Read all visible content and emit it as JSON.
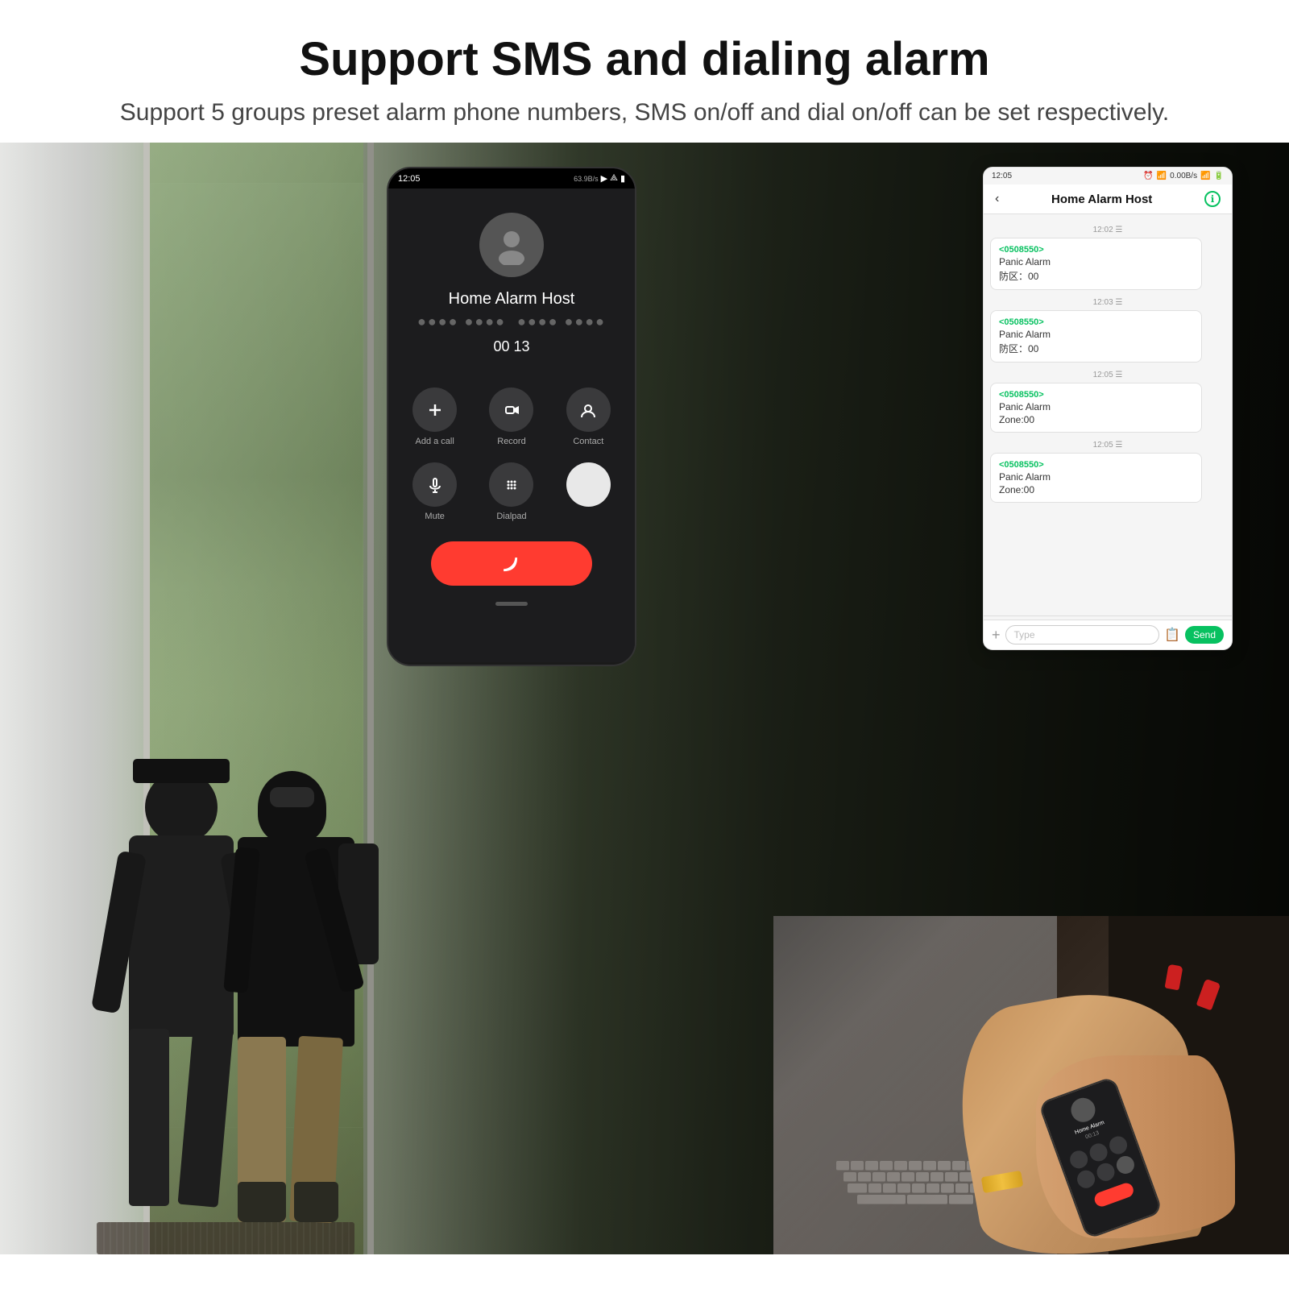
{
  "header": {
    "title": "Support SMS and dialing alarm",
    "subtitle": "Support 5 groups preset alarm phone numbers, SMS on/off and dial on/off can be set respectively."
  },
  "phone_call": {
    "status_bar": {
      "time": "12:05",
      "signal": "63.9B/s"
    },
    "caller_name": "Home Alarm Host",
    "caller_number": "●●●●●●●● ●●●●●●●●",
    "duration": "00 13",
    "buttons": [
      {
        "label": "Add a call",
        "icon": "plus"
      },
      {
        "label": "Record",
        "icon": "record"
      },
      {
        "label": "Contact",
        "icon": "contact"
      },
      {
        "label": "Mute",
        "icon": "mute"
      },
      {
        "label": "Dialpad",
        "icon": "dialpad"
      }
    ]
  },
  "phone_sms": {
    "status_bar": {
      "time": "12:05",
      "speed": "0.00B/s"
    },
    "contact_name": "Home Alarm Host",
    "messages": [
      {
        "time": "12:02",
        "from": "<0508550>",
        "lines": [
          "Panic Alarm",
          "防区：00"
        ]
      },
      {
        "time": "12:03",
        "from": "<0508550>",
        "lines": [
          "Panic Alarm",
          "防区：00"
        ]
      },
      {
        "time": "12:05",
        "from": "<0508550>",
        "lines": [
          "Panic Alarm",
          "Zone:00"
        ]
      },
      {
        "time": "12:05",
        "from": "<0508550>",
        "lines": [
          "Panic Alarm",
          "Zone:00"
        ]
      }
    ],
    "input_placeholder": "Type",
    "send_label": "Send"
  },
  "colors": {
    "green": "#07c160",
    "red": "#ff3b30",
    "dark_bg": "#1c1c1e",
    "sms_bg": "#f5f5f5"
  }
}
